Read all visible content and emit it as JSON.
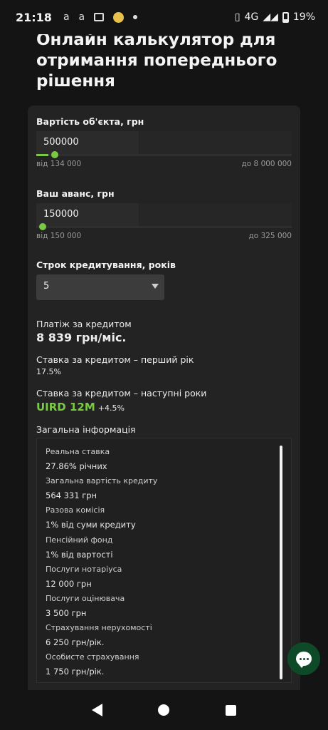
{
  "status_bar": {
    "time": "21:18",
    "left_icons": [
      "a",
      "a"
    ],
    "network": "4G",
    "battery": "19%"
  },
  "page_title": "Онлайн калькулятор для отримання попереднього рішення",
  "property": {
    "label": "Вартість об'єкта, грн",
    "value": "500000",
    "min_label": "від 134 000",
    "max_label": "до 8 000 000",
    "slider_fraction": 0.047
  },
  "advance": {
    "label": "Ваш аванс, грн",
    "value": "150000",
    "min_label": "від 150 000",
    "max_label": "до 325 000",
    "slider_fraction": 0.0
  },
  "term": {
    "label": "Строк кредитування, років",
    "selected": "5"
  },
  "payment": {
    "label": "Платіж за кредитом",
    "value": "8 839 грн/міс."
  },
  "rate_first": {
    "label": "Ставка за кредитом – перший рік",
    "value": "17.5%"
  },
  "rate_next": {
    "label": "Ставка за кредитом – наступні роки",
    "index": "UIRD 12M",
    "add": "+4.5%"
  },
  "info": {
    "title": "Загальна інформація",
    "items": [
      {
        "label": "Реальна ставка",
        "value": "27.86% річних"
      },
      {
        "label": "Загальна вартість кредиту",
        "value": "564 331 грн"
      },
      {
        "label": "Разова комісія",
        "value": "1% від суми кредиту"
      },
      {
        "label": "Пенсійний фонд",
        "value": "1% від вартості"
      },
      {
        "label": "Послуги нотаріуса",
        "value": "12 000 грн"
      },
      {
        "label": "Послуги оцінювача",
        "value": "3 500 грн"
      },
      {
        "label": "Страхування нерухомості",
        "value": "6 250 грн/рік."
      },
      {
        "label": "Особисте страхування",
        "value": "1 750 грн/рік."
      }
    ]
  },
  "colors": {
    "accent": "#7ac943",
    "fab": "#0e4a28"
  }
}
